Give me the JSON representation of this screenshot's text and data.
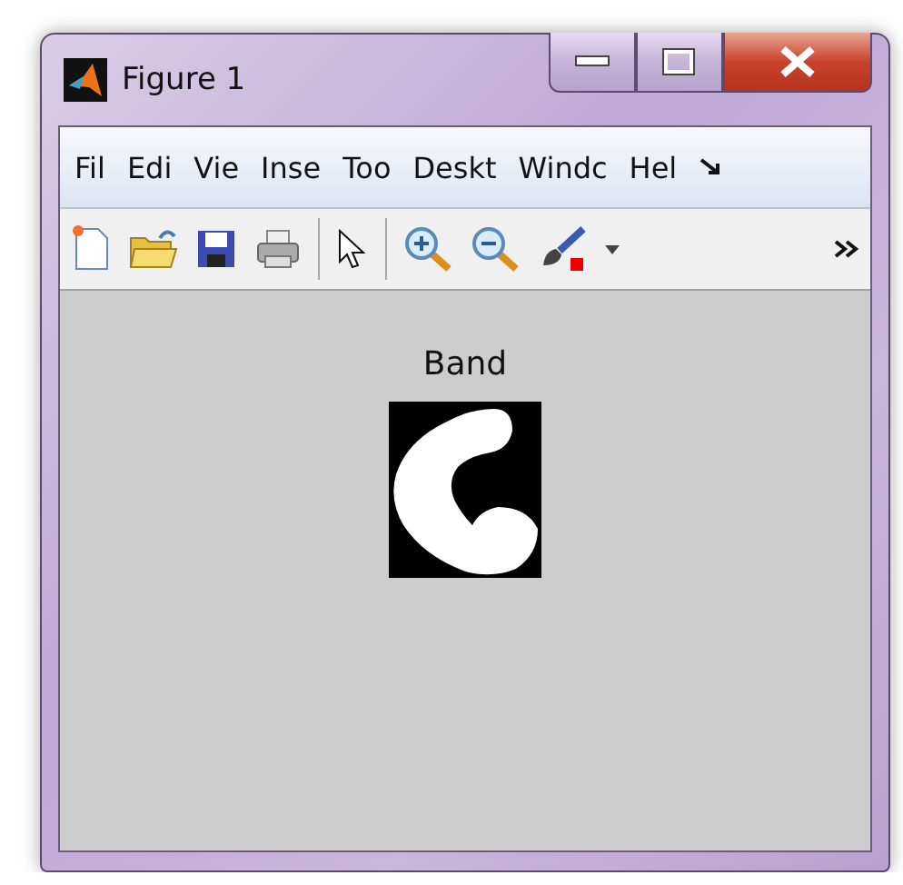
{
  "window": {
    "title": "Figure 1"
  },
  "menu": [
    {
      "label": "Fil"
    },
    {
      "label": "Edi"
    },
    {
      "label": "Vie"
    },
    {
      "label": "Inse"
    },
    {
      "label": "Too"
    },
    {
      "label": "Deskt"
    },
    {
      "label": "Windc"
    },
    {
      "label": "Hel"
    }
  ],
  "figure": {
    "title": "Band"
  }
}
